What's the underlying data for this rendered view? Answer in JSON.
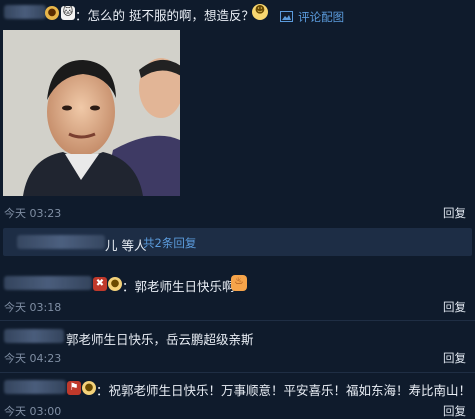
{
  "comments": [
    {
      "text": "：怎么的 挺不服的啊，想造反？",
      "view_image_label": "评论配图",
      "time": "今天 03:23",
      "reply_label": "回复"
    },
    {
      "text": "：郭老师生日快乐啊",
      "time": "今天 03:18",
      "reply_label": "回复"
    },
    {
      "text": "郭老师生日快乐，岳云鹏超级亲斯",
      "time": "今天 04:23",
      "reply_label": "回复"
    },
    {
      "text": "：祝郭老师生日快乐！万事顺意！平安喜乐！福如东海！寿比南山！",
      "time": "今天 03:00",
      "reply_label": "回复"
    }
  ],
  "reply_summary": {
    "people_suffix": "儿 等人",
    "total_link": "共2条回复"
  },
  "icons": {
    "image": "image-icon",
    "emoji": "emoji-icon"
  },
  "colors": {
    "background": "#0f1b2c",
    "link": "#5b9bdc",
    "summary_bar": "#1d2d45"
  }
}
